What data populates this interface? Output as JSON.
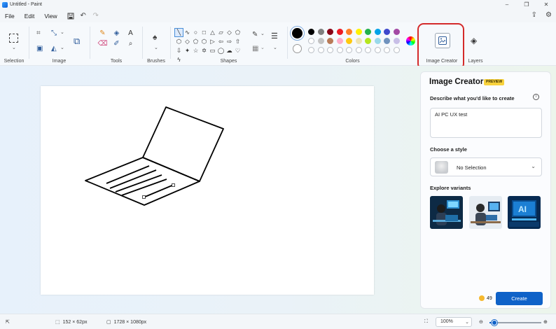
{
  "window": {
    "title": "Untitled - Paint",
    "controls": [
      "–",
      "❐",
      "✕"
    ]
  },
  "menu": {
    "file": "File",
    "edit": "Edit",
    "view": "View"
  },
  "ribbon": {
    "groups": {
      "selection": "Selection",
      "image": "Image",
      "tools": "Tools",
      "brushes": "Brushes",
      "shapes": "Shapes",
      "colors": "Colors",
      "image_creator": "Image Creator",
      "layers": "Layers"
    },
    "tool_glyphs": [
      "✎",
      "◈",
      "A",
      "⌫",
      "✐",
      "⌕"
    ],
    "shape_glyphs": [
      "╲",
      "∿",
      "○",
      "□",
      "△",
      "▱",
      "◇",
      "⬠",
      "⬡",
      "◇",
      "⬠",
      "⬡",
      "▷",
      "⇦",
      "⇨",
      "⇧",
      "⇩",
      "✦",
      "☆",
      "✡",
      "▭",
      "◯",
      "☁",
      "♡",
      "ϟ"
    ],
    "current_color": "#000000",
    "secondary_color": "#ffffff",
    "palette_row1": [
      "#000000",
      "#7f7f7f",
      "#880015",
      "#ed1c24",
      "#ff7f27",
      "#fff200",
      "#22b14c",
      "#00a2e8",
      "#3f48cc",
      "#a349a4"
    ],
    "palette_row2": [
      "#ffffff",
      "#c3c3c3",
      "#b97a57",
      "#ffaec9",
      "#ffc90e",
      "#efe4b0",
      "#b5e61d",
      "#99d9ea",
      "#7092be",
      "#c8bfe7"
    ],
    "palette_row3": [
      "empty",
      "empty",
      "empty",
      "empty",
      "empty",
      "empty",
      "empty",
      "empty",
      "empty",
      "empty"
    ]
  },
  "image_creator": {
    "title": "Image Creator",
    "badge": "PREVIEW",
    "describe_label": "Describe what you'd like to create",
    "prompt_value": "AI PC UX test",
    "style_label": "Choose a style",
    "style_value": "No Selection",
    "variants_label": "Explore variants",
    "credits": "49",
    "create_label": "Create"
  },
  "status": {
    "selection_size": "152 × 62px",
    "canvas_size": "1728 × 1080px",
    "zoom": "100%",
    "zoom_level": 0.1
  }
}
